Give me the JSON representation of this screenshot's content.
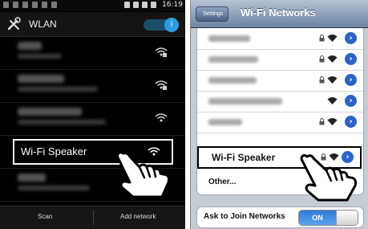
{
  "android": {
    "status_bar": {
      "time": "16:19"
    },
    "header": {
      "title": "WLAN",
      "toggle_icon": "info-icon"
    },
    "networks": [
      {
        "obscured": true,
        "secured": true
      },
      {
        "obscured": true,
        "secured": true
      },
      {
        "obscured": true,
        "secured": false
      },
      {
        "name": "Wi-Fi Speaker",
        "secured": false,
        "highlighted": true
      },
      {
        "obscured": true,
        "secured": false
      }
    ],
    "bottom_bar": {
      "scan_label": "Scan",
      "add_label": "Add network"
    },
    "accent_color": "#2e9be0"
  },
  "ios": {
    "nav": {
      "back_label": "Settings",
      "title": "Wi-Fi Networks"
    },
    "networks": [
      {
        "obscured": true,
        "secured": true
      },
      {
        "obscured": true,
        "secured": true
      },
      {
        "obscured": true,
        "secured": true
      },
      {
        "obscured": true,
        "secured": false
      },
      {
        "obscured": true,
        "secured": true
      },
      {
        "name": "Wi-Fi Speaker",
        "secured": true,
        "highlighted": true
      }
    ],
    "other_label": "Other...",
    "ask_to_join": {
      "label": "Ask to Join Networks",
      "state": "ON"
    },
    "accent_color": "#2a63c9"
  },
  "pointer_icon": "tap-hand-icon"
}
